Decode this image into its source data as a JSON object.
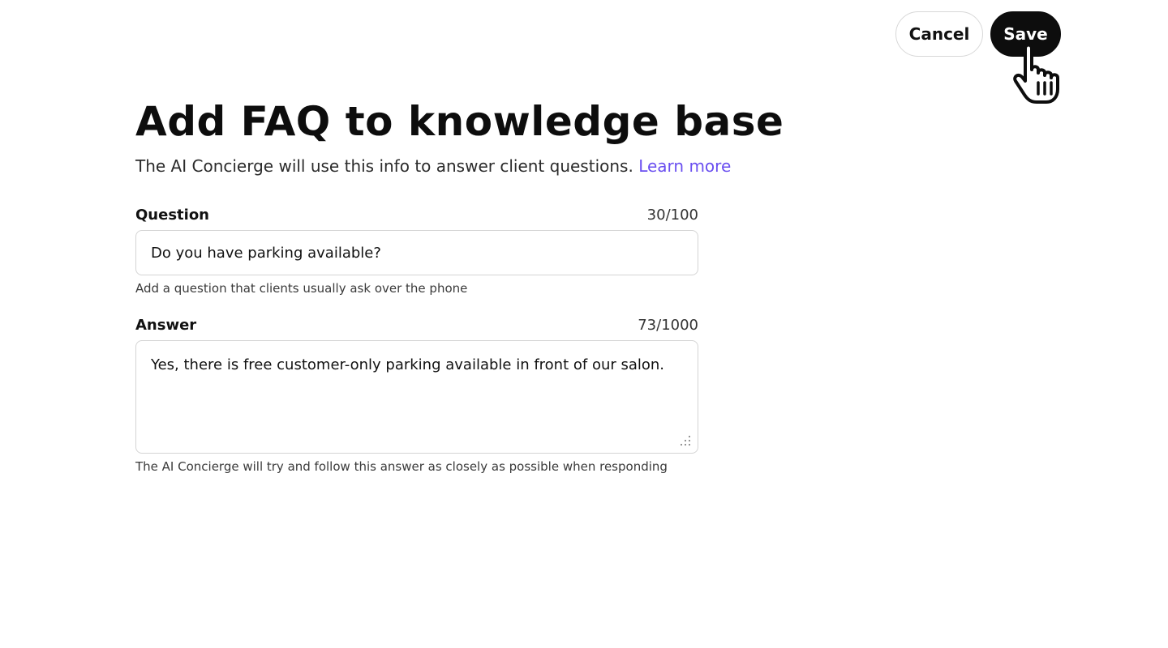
{
  "header": {
    "cancel_label": "Cancel",
    "save_label": "Save"
  },
  "page": {
    "title": "Add FAQ to knowledge base",
    "subtitle": "The AI Concierge will use this info to answer client questions.",
    "learn_more": "Learn more"
  },
  "question": {
    "label": "Question",
    "count": "30/100",
    "value": "Do you have parking available?",
    "hint": "Add a question that clients usually ask over the phone"
  },
  "answer": {
    "label": "Answer",
    "count": "73/1000",
    "value": "Yes, there is free customer-only parking available in front of our salon.",
    "hint": "The AI Concierge will try and follow this answer as closely as possible when responding"
  },
  "colors": {
    "accent_link": "#6a4ff0",
    "save_bg": "#0d0d0d",
    "border": "#d4d4d4"
  },
  "icons": {
    "cursor": "hand-pointer-icon",
    "resize": "resize-grip-icon"
  }
}
